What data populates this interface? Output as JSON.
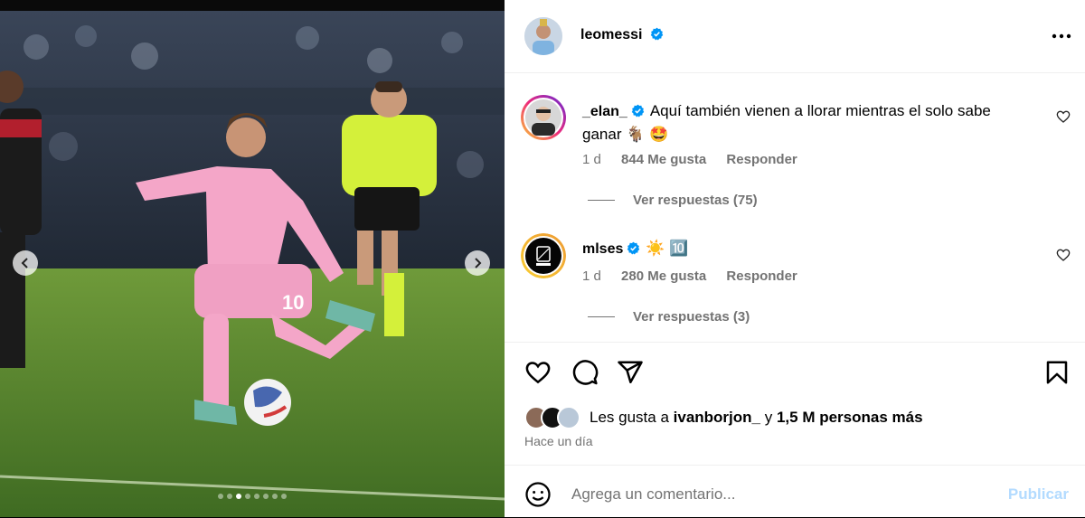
{
  "post": {
    "author": "leomessi",
    "author_verified_icon": "verified-badge-icon",
    "more_icon": "more-options-icon"
  },
  "media": {
    "icons": {
      "prev": "chevron-left-icon",
      "next": "chevron-right-icon"
    },
    "slide_count": 8,
    "active_slide": 2
  },
  "comments": [
    {
      "username": "_elan_",
      "text": "Aquí también vienen a llorar mientras el solo sabe ganar 🐐 🤩",
      "age": "1 d",
      "likes": "844 Me gusta",
      "reply_label": "Responder",
      "view_replies": "Ver respuestas (75)"
    },
    {
      "username": "mlses",
      "text": "☀️ 🔟",
      "age": "1 d",
      "likes": "280 Me gusta",
      "reply_label": "Responder",
      "view_replies": "Ver respuestas (3)"
    }
  ],
  "actions": {
    "icons": [
      "heart-icon",
      "comment-icon",
      "share-icon",
      "bookmark-icon"
    ]
  },
  "likes": {
    "prefix": "Les gusta a",
    "user": "ivanborjon_",
    "connector": "y",
    "count_text": "1,5 M personas más"
  },
  "timestamp": "Hace un día",
  "composer": {
    "placeholder": "Agrega un comentario...",
    "publish_label": "Publicar",
    "emoji_icon": "emoji-icon"
  },
  "colors": {
    "verified": "#0095f6",
    "publish_disabled": "#b3dbff",
    "secondary_text": "#737373",
    "kit_pink": "#f4a6c8"
  }
}
